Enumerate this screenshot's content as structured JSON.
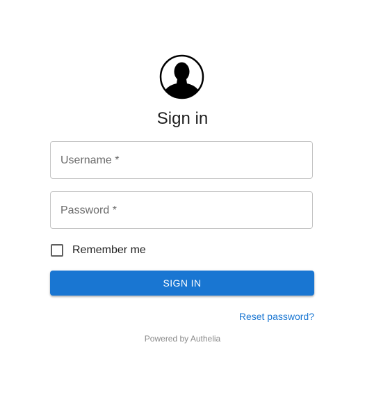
{
  "header": {
    "avatar_icon": "user-silhouette-icon",
    "title": "Sign in"
  },
  "form": {
    "username": {
      "label": "Username *",
      "value": ""
    },
    "password": {
      "label": "Password *",
      "value": ""
    },
    "remember": {
      "label": "Remember me",
      "checked": false
    },
    "submit_label": "SIGN IN",
    "reset_link": "Reset password?"
  },
  "footer": {
    "powered_by": "Powered by Authelia"
  },
  "colors": {
    "accent": "#1976d2",
    "border": "#c4c4c4",
    "text": "#1f1f1f"
  }
}
